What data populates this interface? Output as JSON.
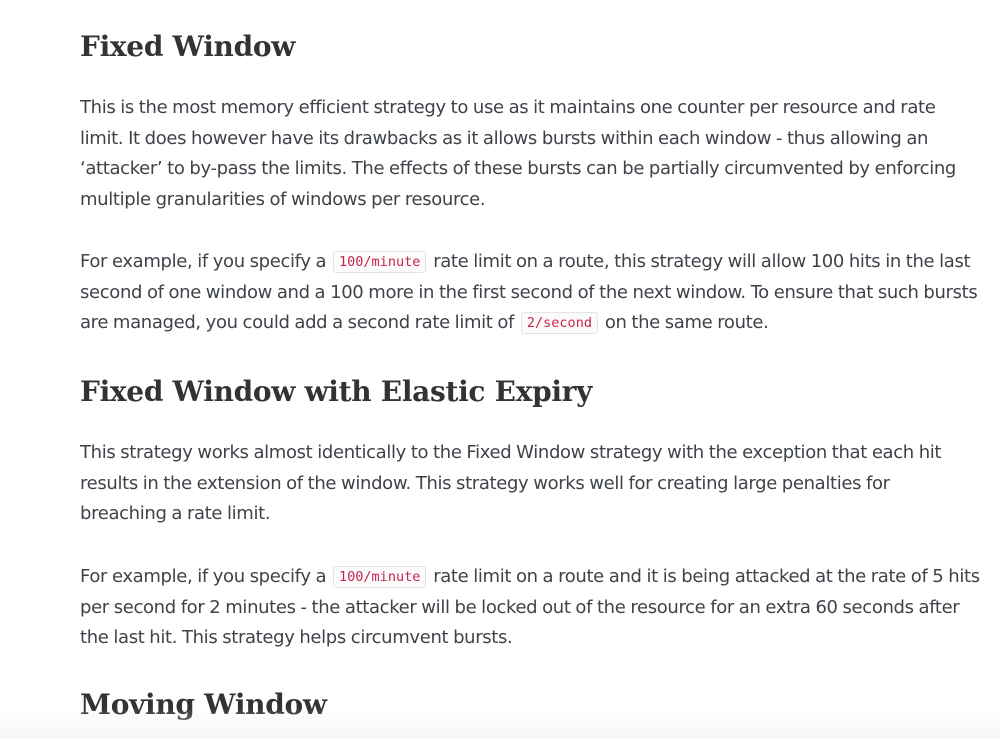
{
  "sections": [
    {
      "heading": "Fixed Window",
      "p1": "This is the most memory efficient strategy to use as it maintains one counter per resource and rate limit. It does however have its drawbacks as it allows bursts within each window - thus allowing an ‘attacker’ to by-pass the limits. The effects of these bursts can be partially circumvented by enforcing multiple granularities of windows per resource.",
      "p2": {
        "t1": "For example, if you specify a",
        "code1": "100/minute",
        "t2": "rate limit on a route, this strategy will allow 100 hits in the last second of one window and a 100 more in the first second of the next window. To ensure that such bursts are managed, you could add a second rate limit of",
        "code2": "2/second",
        "t3": "on the same route."
      }
    },
    {
      "heading": "Fixed Window with Elastic Expiry",
      "p1": "This strategy works almost identically to the Fixed Window strategy with the exception that each hit results in the extension of the window. This strategy works well for creating large penalties for breaching a rate limit.",
      "p2": {
        "t1": "For example, if you specify a",
        "code1": "100/minute",
        "t2": "rate limit on a route and it is being attacked at the rate of 5 hits per second for 2 minutes - the attacker will be locked out of the resource for an extra 60 seconds after the last hit. This strategy helps circumvent bursts."
      }
    },
    {
      "heading": "Moving Window"
    }
  ]
}
